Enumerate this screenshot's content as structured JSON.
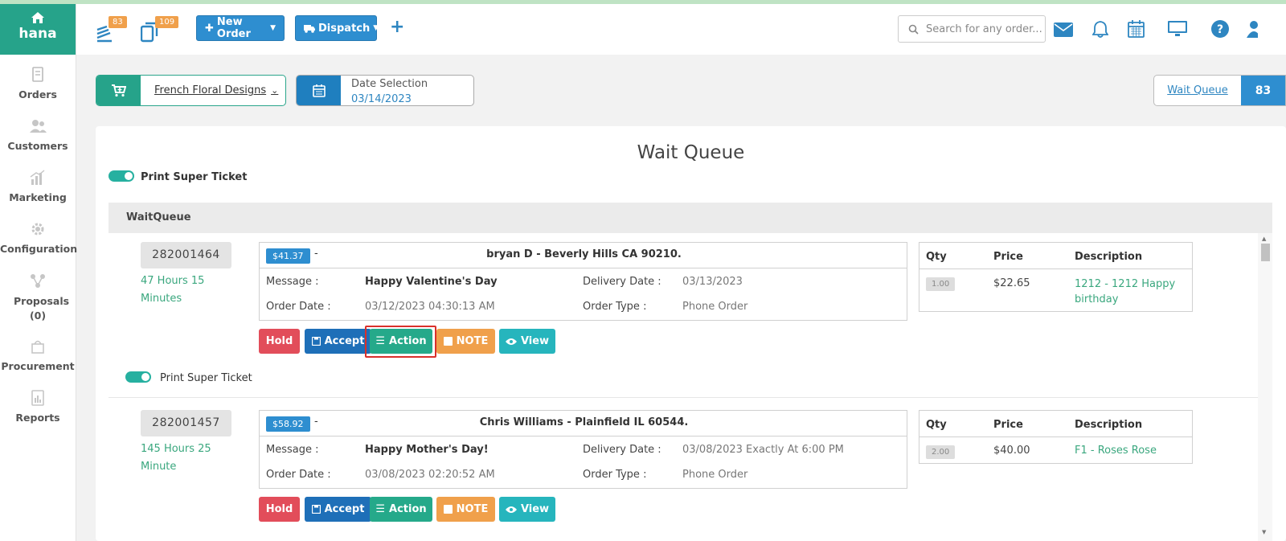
{
  "app": {
    "logo_text": "hana"
  },
  "sidebar": {
    "items": [
      {
        "label": "Orders",
        "icon": "document-icon"
      },
      {
        "label": "Customers",
        "icon": "users-icon"
      },
      {
        "label": "Marketing",
        "icon": "bar-chart-icon"
      },
      {
        "label": "Configuration",
        "icon": "gear-icon"
      },
      {
        "label": "Proposals (0)",
        "icon": "network-icon"
      },
      {
        "label": "Procurement",
        "icon": "procurement-icon"
      },
      {
        "label": "Reports",
        "icon": "report-icon"
      }
    ]
  },
  "topbar": {
    "queue_badge": "83",
    "copies_badge": "109",
    "new_order_label": "New Order",
    "dispatch_label": "Dispatch",
    "search_placeholder": "Search for any order..."
  },
  "filters": {
    "store_name": "French Floral Designs",
    "date_label": "Date Selection",
    "date_value": "03/14/2023",
    "wait_queue_label": "Wait Queue",
    "wait_queue_count": "83"
  },
  "page": {
    "title": "Wait Queue",
    "print_super_ticket": "Print Super Ticket",
    "section_header": "WaitQueue"
  },
  "labels": {
    "message": "Message :",
    "order_date": "Order Date :",
    "delivery_date": "Delivery Date :",
    "order_type": "Order Type :",
    "qty": "Qty",
    "price": "Price",
    "description": "Description",
    "hold": "Hold",
    "accept": "Accept",
    "action": "Action",
    "note": "NOTE",
    "view": "View"
  },
  "orders": [
    {
      "number": "282001464",
      "elapsed": "47 Hours 15 Minutes",
      "amount": "$41.37",
      "customer": "bryan D - Beverly Hills CA 90210.",
      "message": "Happy Valentine's Day",
      "order_date": "03/12/2023 04:30:13 AM",
      "delivery_date": "03/13/2023",
      "order_type": "Phone Order",
      "items": [
        {
          "qty": "1.00",
          "price": "$22.65",
          "description": "1212 - 1212 Happy birthday"
        }
      ],
      "print_super_ticket": "Print Super Ticket"
    },
    {
      "number": "282001457",
      "elapsed": "145 Hours 25 Minute",
      "amount": "$58.92",
      "customer": "Chris Williams - Plainfield IL 60544.",
      "message": "Happy Mother's Day!",
      "order_date": "03/08/2023 02:20:52 AM",
      "delivery_date": "03/08/2023 Exactly At 6:00 PM",
      "order_type": "Phone Order",
      "items": [
        {
          "qty": "2.00",
          "price": "$40.00",
          "description": "F1 - Roses Rose"
        }
      ]
    }
  ],
  "colors": {
    "brand_green": "#26a38a",
    "primary_blue": "#2e8ed0",
    "hold_red": "#e24d5a",
    "note_orange": "#f0a04b",
    "view_teal": "#26b5bd",
    "highlight_red": "#d9302b"
  }
}
